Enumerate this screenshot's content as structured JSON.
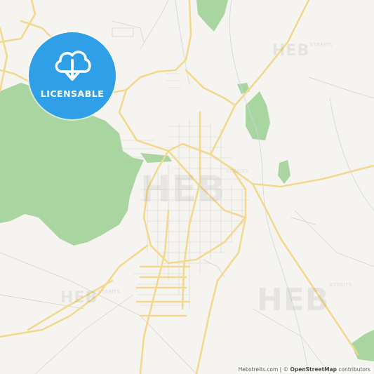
{
  "badge": {
    "label": "LICENSABLE",
    "icon": "cloud-download-icon",
    "color": "#2f9fe7"
  },
  "watermark": {
    "text": "HEB",
    "sup": "STREITS"
  },
  "attribution": {
    "site": "Hebstreits.com",
    "separator": " | © ",
    "osm": "OpenStreetMap",
    "suffix": " contributors"
  },
  "colors": {
    "land": "#f5f4f1",
    "forest": "#a8d5a0",
    "road": "#f3dc96",
    "minor_road": "#c9c5bd",
    "water": "#c4ccd6"
  }
}
